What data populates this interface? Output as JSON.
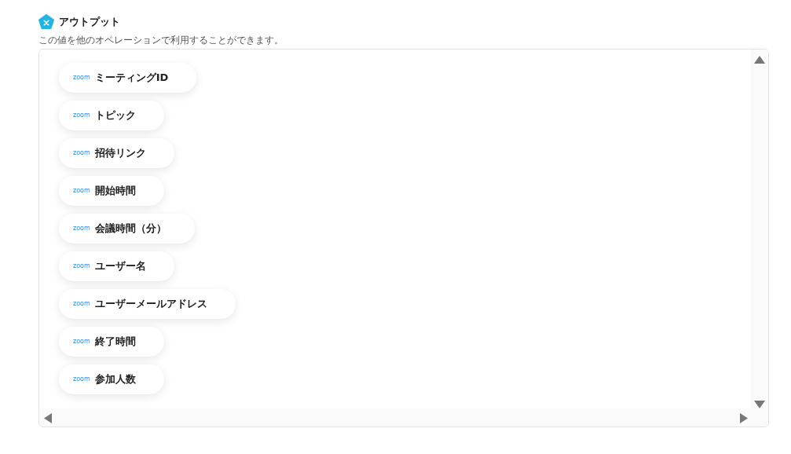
{
  "title": "アウトプット",
  "description": "この値を他のオペレーションで利用することができます。",
  "outputs": [
    {
      "source": "zoom",
      "label": "ミーティングID"
    },
    {
      "source": "zoom",
      "label": "トピック"
    },
    {
      "source": "zoom",
      "label": "招待リンク"
    },
    {
      "source": "zoom",
      "label": "開始時間"
    },
    {
      "source": "zoom",
      "label": "会議時間（分）"
    },
    {
      "source": "zoom",
      "label": "ユーザー名"
    },
    {
      "source": "zoom",
      "label": "ユーザーメールアドレス"
    },
    {
      "source": "zoom",
      "label": "終了時間"
    },
    {
      "source": "zoom",
      "label": "参加人数"
    }
  ]
}
